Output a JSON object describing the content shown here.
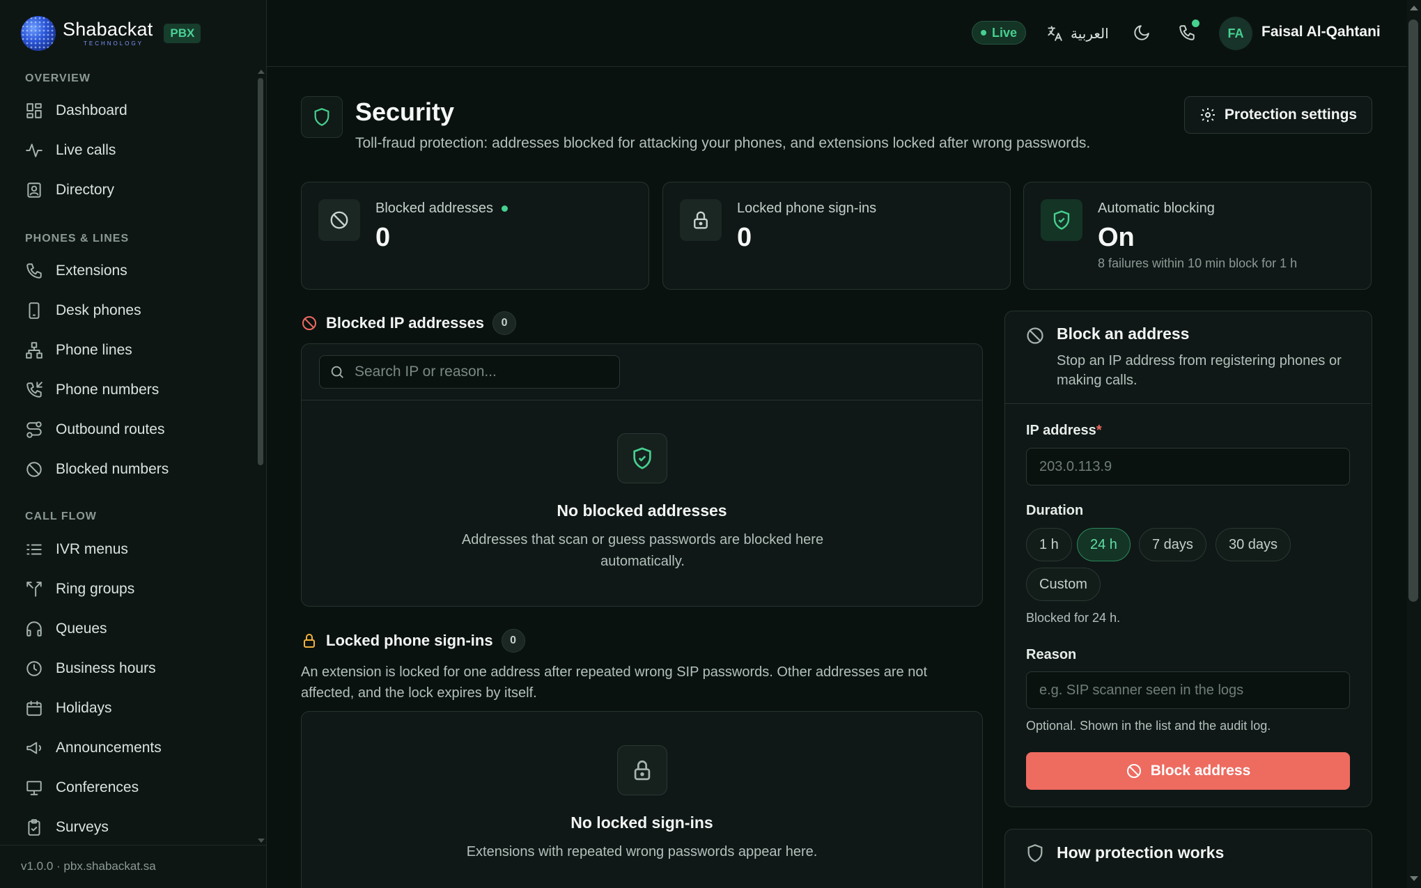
{
  "brand": {
    "name": "Shabackat",
    "sub": "TECHNOLOGY",
    "badge": "PBX"
  },
  "sidebar": {
    "sections": [
      {
        "title": "OVERVIEW",
        "items": [
          {
            "label": "Dashboard",
            "icon": "dashboard-icon"
          },
          {
            "label": "Live calls",
            "icon": "activity-icon"
          },
          {
            "label": "Directory",
            "icon": "contact-card-icon"
          }
        ]
      },
      {
        "title": "PHONES & LINES",
        "items": [
          {
            "label": "Extensions",
            "icon": "phone-icon"
          },
          {
            "label": "Desk phones",
            "icon": "device-icon"
          },
          {
            "label": "Phone lines",
            "icon": "network-icon"
          },
          {
            "label": "Phone numbers",
            "icon": "phone-incoming-icon"
          },
          {
            "label": "Outbound routes",
            "icon": "route-icon"
          },
          {
            "label": "Blocked numbers",
            "icon": "ban-icon"
          }
        ]
      },
      {
        "title": "CALL FLOW",
        "items": [
          {
            "label": "IVR menus",
            "icon": "menu-list-icon"
          },
          {
            "label": "Ring groups",
            "icon": "split-icon"
          },
          {
            "label": "Queues",
            "icon": "headset-icon"
          },
          {
            "label": "Business hours",
            "icon": "clock-icon"
          },
          {
            "label": "Holidays",
            "icon": "calendar-icon"
          },
          {
            "label": "Announcements",
            "icon": "megaphone-icon"
          },
          {
            "label": "Conferences",
            "icon": "presentation-icon"
          },
          {
            "label": "Surveys",
            "icon": "clipboard-check-icon"
          }
        ]
      }
    ],
    "footer": "v1.0.0 · pbx.shabackat.sa"
  },
  "header": {
    "live": "Live",
    "language": "العربية",
    "user_initials": "FA",
    "user_name": "Faisal Al-Qahtani"
  },
  "page": {
    "title": "Security",
    "subtitle": "Toll-fraud protection: addresses blocked for attacking your phones, and extensions locked after wrong passwords.",
    "settings_button": "Protection settings"
  },
  "stats": {
    "blocked": {
      "label": "Blocked addresses",
      "value": "0"
    },
    "locked": {
      "label": "Locked phone sign-ins",
      "value": "0"
    },
    "auto": {
      "label": "Automatic blocking",
      "value": "On",
      "note": "8 failures within 10 min block for 1 h"
    }
  },
  "blocked_ips": {
    "title": "Blocked IP addresses",
    "count": "0",
    "search_placeholder": "Search IP or reason...",
    "empty_title": "No blocked addresses",
    "empty_text": "Addresses that scan or guess passwords are blocked here automatically."
  },
  "locked": {
    "title": "Locked phone sign-ins",
    "count": "0",
    "description": "An extension is locked for one address after repeated wrong SIP passwords. Other addresses are not affected, and the lock expires by itself.",
    "empty_title": "No locked sign-ins",
    "empty_text": "Extensions with repeated wrong passwords appear here."
  },
  "block_form": {
    "title": "Block an address",
    "subtitle": "Stop an IP address from registering phones or making calls.",
    "ip_label": "IP address",
    "required_mark": "*",
    "ip_placeholder": "203.0.113.9",
    "duration_label": "Duration",
    "durations": [
      "1 h",
      "24 h",
      "7 days",
      "30 days",
      "Custom"
    ],
    "selected_duration": "24 h",
    "duration_hint": "Blocked for 24 h.",
    "reason_label": "Reason",
    "reason_placeholder": "e.g. SIP scanner seen in the logs",
    "reason_hint": "Optional. Shown in the list and the audit log.",
    "submit": "Block address"
  },
  "how": {
    "title": "How protection works"
  },
  "colors": {
    "accent": "#47d08f",
    "danger": "#ee6b60",
    "background": "#0a1210"
  }
}
